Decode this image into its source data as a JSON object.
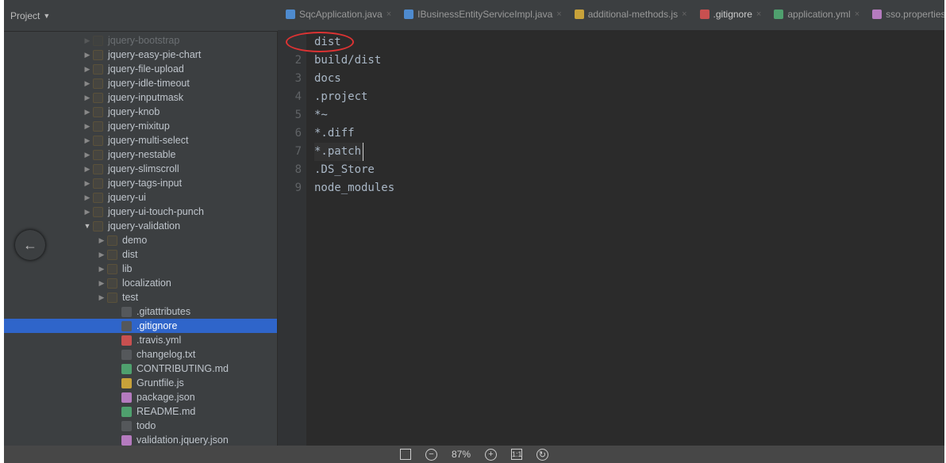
{
  "project_label": "Project",
  "top_icons": [
    "collapse",
    "settings",
    "hide"
  ],
  "tabs": [
    {
      "label": "SqcApplication.java",
      "icon": "java"
    },
    {
      "label": "IBusinessEntityServiceImpl.java",
      "icon": "java"
    },
    {
      "label": "additional-methods.js",
      "icon": "js"
    },
    {
      "label": ".gitignore",
      "icon": "git",
      "selected": true
    },
    {
      "label": "application.yml",
      "icon": "yml"
    },
    {
      "label": "sso.properties",
      "icon": "prop"
    }
  ],
  "tree": [
    {
      "d": 1,
      "t": "folder",
      "arrow": "closed",
      "label": "jquery-bootstrap",
      "faded": true
    },
    {
      "d": 1,
      "t": "folder",
      "arrow": "closed",
      "label": "jquery-easy-pie-chart"
    },
    {
      "d": 1,
      "t": "folder",
      "arrow": "closed",
      "label": "jquery-file-upload"
    },
    {
      "d": 1,
      "t": "folder",
      "arrow": "closed",
      "label": "jquery-idle-timeout"
    },
    {
      "d": 1,
      "t": "folder",
      "arrow": "closed",
      "label": "jquery-inputmask"
    },
    {
      "d": 1,
      "t": "folder",
      "arrow": "closed",
      "label": "jquery-knob"
    },
    {
      "d": 1,
      "t": "folder",
      "arrow": "closed",
      "label": "jquery-mixitup"
    },
    {
      "d": 1,
      "t": "folder",
      "arrow": "closed",
      "label": "jquery-multi-select"
    },
    {
      "d": 1,
      "t": "folder",
      "arrow": "closed",
      "label": "jquery-nestable"
    },
    {
      "d": 1,
      "t": "folder",
      "arrow": "closed",
      "label": "jquery-slimscroll"
    },
    {
      "d": 1,
      "t": "folder",
      "arrow": "closed",
      "label": "jquery-tags-input"
    },
    {
      "d": 1,
      "t": "folder",
      "arrow": "closed",
      "label": "jquery-ui"
    },
    {
      "d": 1,
      "t": "folder",
      "arrow": "closed",
      "label": "jquery-ui-touch-punch"
    },
    {
      "d": 1,
      "t": "folder",
      "arrow": "open",
      "label": "jquery-validation"
    },
    {
      "d": 2,
      "t": "folder",
      "arrow": "closed",
      "label": "demo"
    },
    {
      "d": 2,
      "t": "folder",
      "arrow": "closed",
      "label": "dist"
    },
    {
      "d": 2,
      "t": "folder",
      "arrow": "closed",
      "label": "lib"
    },
    {
      "d": 2,
      "t": "folder",
      "arrow": "closed",
      "label": "localization"
    },
    {
      "d": 2,
      "t": "folder",
      "arrow": "closed",
      "label": "test"
    },
    {
      "d": 3,
      "t": "file",
      "label": ".gitattributes"
    },
    {
      "d": 3,
      "t": "file",
      "label": ".gitignore",
      "selected": true
    },
    {
      "d": 3,
      "t": "yml",
      "label": ".travis.yml"
    },
    {
      "d": 3,
      "t": "file",
      "label": "changelog.txt"
    },
    {
      "d": 3,
      "t": "md",
      "label": "CONTRIBUTING.md"
    },
    {
      "d": 3,
      "t": "js",
      "label": "Gruntfile.js"
    },
    {
      "d": 3,
      "t": "json",
      "label": "package.json"
    },
    {
      "d": 3,
      "t": "md",
      "label": "README.md"
    },
    {
      "d": 3,
      "t": "file",
      "label": "todo"
    },
    {
      "d": 3,
      "t": "json",
      "label": "validation.jquery.json"
    }
  ],
  "editor": {
    "lines": [
      "dist",
      "build/dist",
      "docs",
      ".project",
      "*~",
      "*.diff",
      "*.patch",
      ".DS_Store",
      "node_modules"
    ],
    "caret_line": 7
  },
  "viewer": {
    "zoom": "87%",
    "ratio": "1:1"
  }
}
